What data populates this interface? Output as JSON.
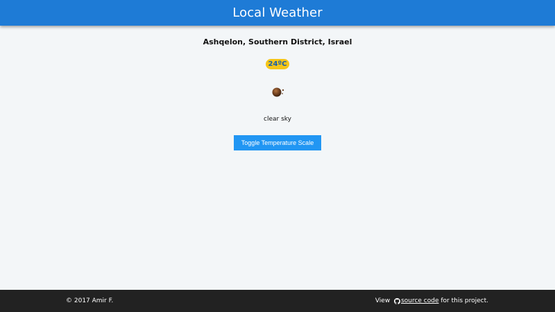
{
  "header": {
    "title": "Local Weather",
    "background_color": "#1e7bd6"
  },
  "weather": {
    "location": "Ashqelon, Southern District, Israel",
    "temperature": "24ºC",
    "condition": "clear sky",
    "icon": "clear-sky-night-moon-icon",
    "badge_color": "#f5c518"
  },
  "controls": {
    "toggle_label": "Toggle Temperature Scale",
    "button_color": "#2196f3"
  },
  "footer": {
    "copyright": "© 2017 Amir F.",
    "view_prefix": "View ",
    "github_icon": "github-icon",
    "source_link_label": "source code",
    "view_suffix": " for this project.",
    "background_color": "#222222"
  }
}
